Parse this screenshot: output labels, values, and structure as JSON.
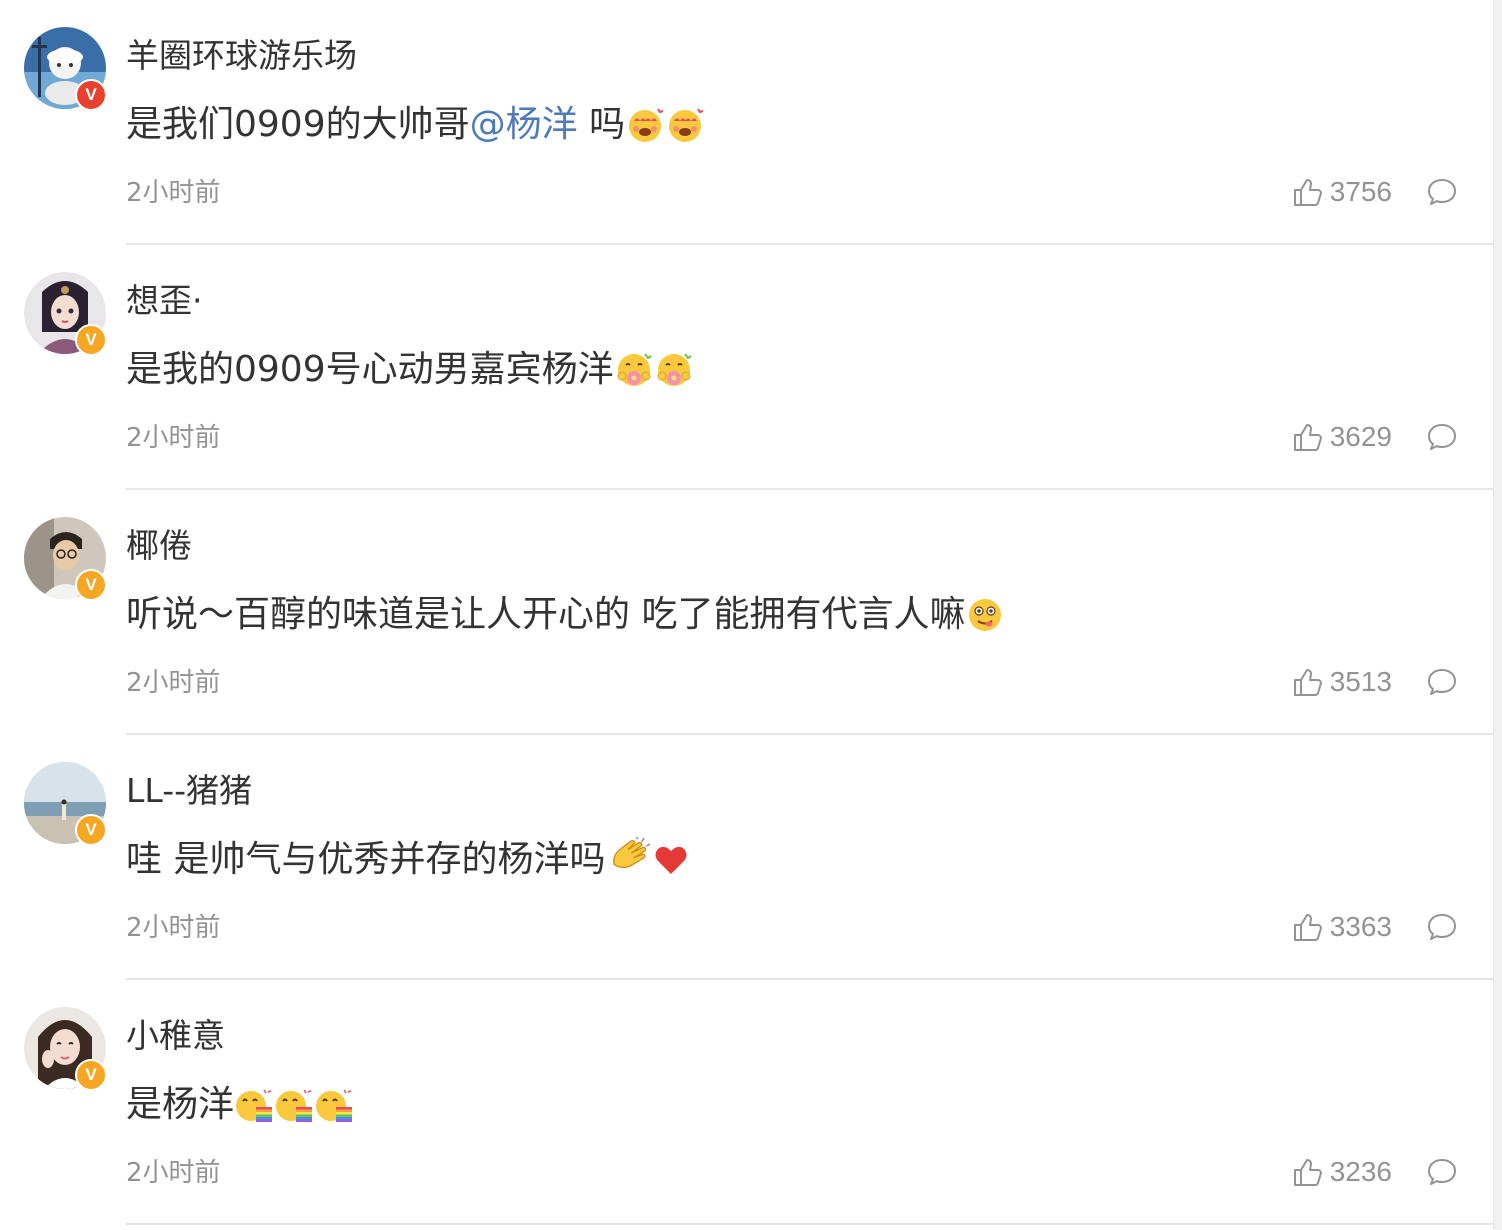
{
  "comments": [
    {
      "username": "羊圈环球游乐场",
      "text_before": "是我们0909的大帅哥",
      "mention": "@杨洋",
      "text_after": " 吗",
      "emojis": [
        "heart-eyes-emoji",
        "heart-eyes-emoji"
      ],
      "time": "2小时前",
      "likes": "3756",
      "badge": "V",
      "badge_color": "#e8412c"
    },
    {
      "username": "想歪·",
      "text_before": "是我的0909号心动男嘉宾杨洋",
      "mention": "",
      "text_after": "",
      "emojis": [
        "flower-hug-emoji",
        "flower-hug-emoji"
      ],
      "time": "2小时前",
      "likes": "3629",
      "badge": "V",
      "badge_color": "#f5a623"
    },
    {
      "username": "椰倦",
      "text_before": "听说～百醇的味道是让人开心的 吃了能拥有代言人嘛",
      "mention": "",
      "text_after": "",
      "emojis": [
        "yum-emoji"
      ],
      "time": "2小时前",
      "likes": "3513",
      "badge": "V",
      "badge_color": "#f5a623"
    },
    {
      "username": "LL--猪猪",
      "text_before": "哇 是帅气与优秀并存的杨洋吗",
      "mention": "",
      "text_after": "",
      "emojis": [
        "clapping-hands-emoji",
        "red-heart-emoji"
      ],
      "time": "2小时前",
      "likes": "3363",
      "badge": "V",
      "badge_color": "#f5a623"
    },
    {
      "username": "小稚意",
      "text_before": "是杨洋",
      "mention": "",
      "text_after": "",
      "emojis": [
        "rainbow-vomit-emoji",
        "rainbow-vomit-emoji",
        "rainbow-vomit-emoji"
      ],
      "time": "2小时前",
      "likes": "3236",
      "badge": "V",
      "badge_color": "#f5a623"
    }
  ],
  "icons": {
    "like": "thumbs-up-icon",
    "reply": "comment-bubble-icon"
  },
  "colors": {
    "text": "#333333",
    "secondary": "#939393",
    "mention": "#4d7ab8",
    "divider": "#e5e5e5"
  }
}
